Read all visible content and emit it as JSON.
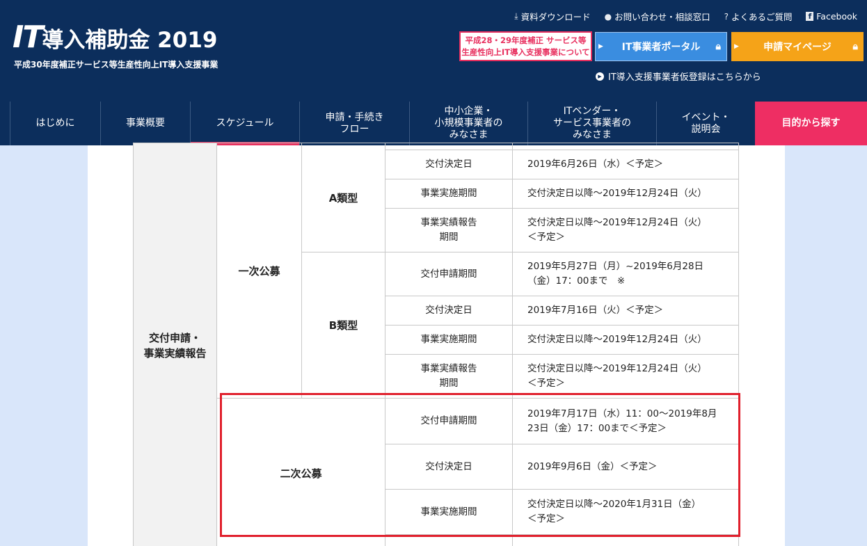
{
  "header": {
    "logo_it": "IT",
    "logo_rest": "導入補助金 2019",
    "subtitle": "平成30年度補正サービス等生産性向上IT導入支援事業",
    "top_links": [
      {
        "icon": "download-icon",
        "glyph": "⤓",
        "label": "資料ダウンロード"
      },
      {
        "icon": "person-icon",
        "glyph": "👤",
        "label": "お問い合わせ・相談窓口"
      },
      {
        "icon": "question-icon",
        "glyph": "?",
        "label": "よくあるご質問"
      },
      {
        "icon": "facebook-icon",
        "glyph": "f",
        "label": "Facebook"
      }
    ],
    "promo_line1": "平成28・29年度補正 サービス等",
    "promo_line2": "生産性向上IT導入支援事業について",
    "it_portal_label": "IT事業者ポータル",
    "mypage_label": "申請マイページ",
    "vendor_link": "IT導入支援事業者仮登録はこちらから",
    "colors": {
      "navy": "#0c2e5c",
      "accent_pink": "#e8305f",
      "portal_blue": "#3a8de0",
      "mypage_orange": "#f5a318"
    }
  },
  "nav": {
    "items": [
      "はじめに",
      "事業概要",
      "スケジュール",
      "申請・手続き\nフロー",
      "中小企業・\n小規模事業者の\nみなさま",
      "ITベンダー・\nサービス事業者の\nみなさま",
      "イベント・\n説明会"
    ],
    "cta": "目的から探す",
    "active_index": 2
  },
  "schedule": {
    "category": "交付申請・\n事業実績報告",
    "phase1": "一次公募",
    "typeA": "A類型",
    "typeB": "B類型",
    "phase2": "二次公募",
    "rowsA": [
      {
        "label": "交付決定日",
        "value": "2019年6月26日（水）＜予定＞"
      },
      {
        "label": "事業実施期間",
        "value": "交付決定日以降～2019年12月24日（火）"
      },
      {
        "label": "事業実績報告\n期間",
        "value": "交付決定日以降～2019年12月24日（火）\n＜予定＞"
      }
    ],
    "rowsB": [
      {
        "label": "交付申請期間",
        "value": "2019年5月27日（月）~2019年6月28日\n（金）17：00まで　※"
      },
      {
        "label": "交付決定日",
        "value": "2019年7月16日（火）＜予定＞"
      },
      {
        "label": "事業実施期間",
        "value": "交付決定日以降～2019年12月24日（火）"
      },
      {
        "label": "事業実績報告\n期間",
        "value": "交付決定日以降～2019年12月24日（火）\n＜予定＞"
      }
    ],
    "rows2": [
      {
        "label": "交付申請期間",
        "value": "2019年7月17日（水）11：00～2019年8月\n23日（金）17：00まで＜予定＞"
      },
      {
        "label": "交付決定日",
        "value": "2019年9月6日（金）＜予定＞"
      },
      {
        "label": "事業実施期間",
        "value": "交付決定日以降～2020年1月31日（金）\n＜予定＞"
      }
    ]
  }
}
